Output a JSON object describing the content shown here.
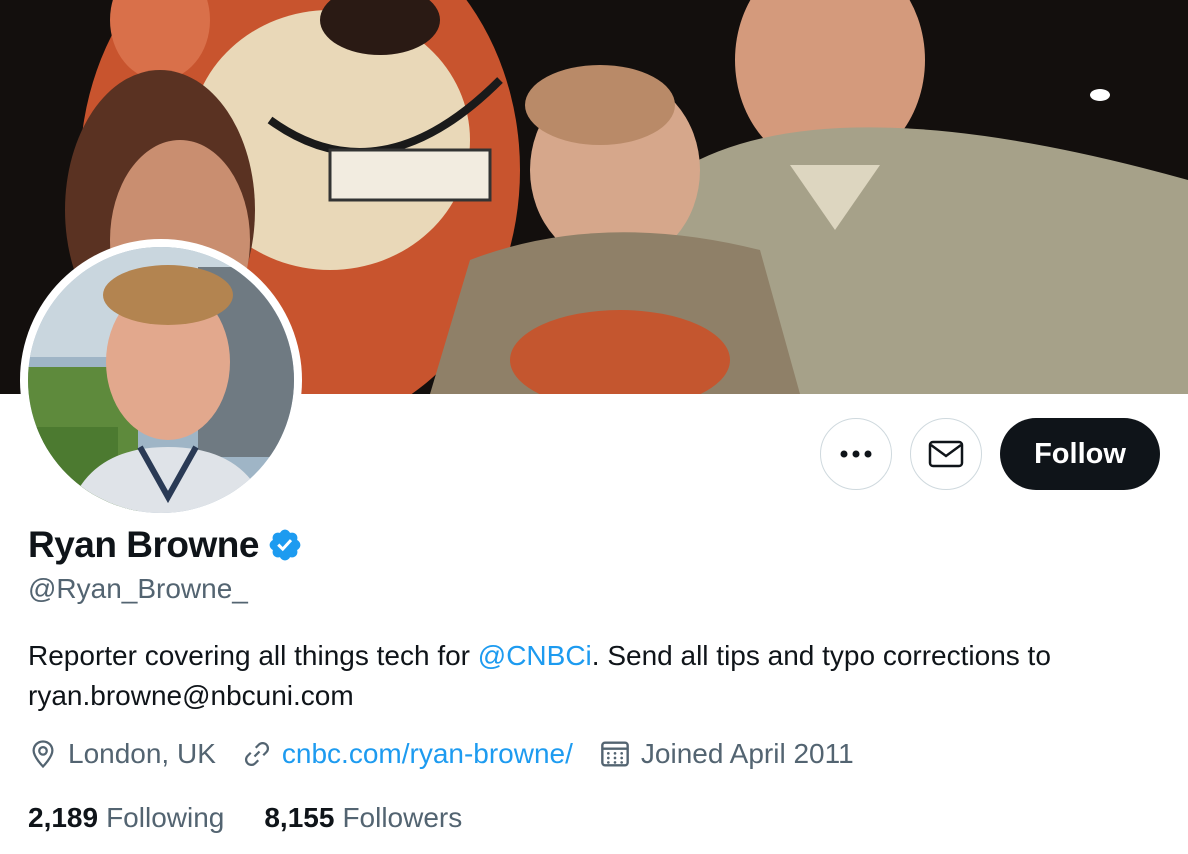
{
  "profile": {
    "display_name": "Ryan Browne",
    "handle": "@Ryan_Browne_",
    "verified": true,
    "bio_prefix": "Reporter covering all things tech for ",
    "bio_mention": "@CNBCi",
    "bio_suffix": ". Send all tips and typo corrections to ryan.browne@nbcuni.com",
    "location": "London, UK",
    "website": "cnbc.com/ryan-browne/",
    "joined": "Joined April 2011"
  },
  "stats": {
    "following_count": "2,189",
    "following_label": "Following",
    "followers_count": "8,155",
    "followers_label": "Followers"
  },
  "actions": {
    "more_icon": "more-horizontal-icon",
    "message_icon": "envelope-icon",
    "follow_label": "Follow"
  },
  "colors": {
    "link": "#1d9bf0",
    "text": "#0f1419",
    "secondary": "#536471",
    "follow_bg": "#0f1419"
  }
}
